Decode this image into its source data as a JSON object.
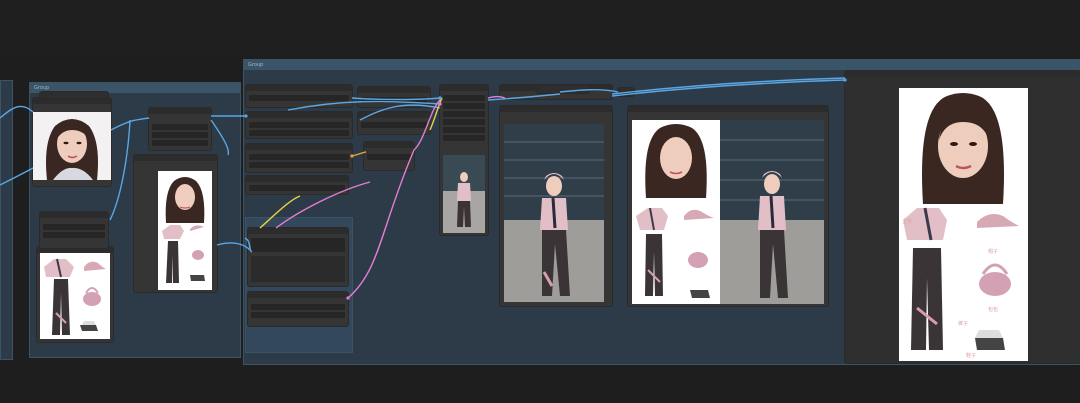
{
  "canvas": {
    "background": "#1e1e1e"
  },
  "groups": {
    "left_group_title": "Group",
    "main_group_title": "Group"
  },
  "colors": {
    "wire_blue": "#5aa7e6",
    "wire_pink": "#e37fd2",
    "wire_yellow": "#e8d040",
    "wire_orange": "#e8a040",
    "group_fill": "#2d3a47",
    "node_fill": "#353535"
  },
  "outfit_labels": {
    "top": "上衣",
    "hat": "帽子",
    "pants": "裤子",
    "bag": "包包",
    "shoes": "鞋子"
  }
}
